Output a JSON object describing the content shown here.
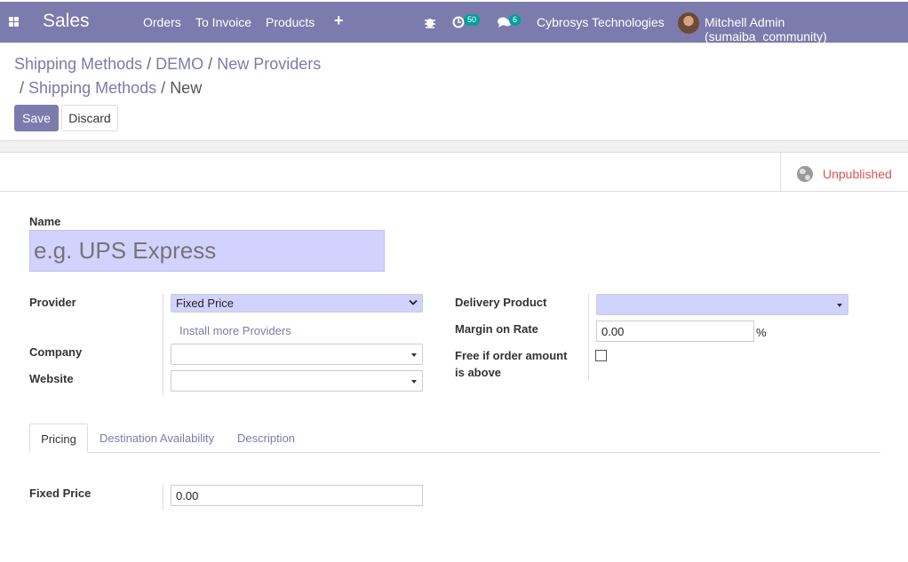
{
  "navbar": {
    "app_name": "Sales",
    "menu": [
      "Orders",
      "To Invoice",
      "Products"
    ],
    "plus_icon": "+",
    "activity_count": "50",
    "message_count": "6",
    "company": "Cybrosys Technologies",
    "user": "Mitchell Admin (sumaiba_community)"
  },
  "breadcrumb": {
    "items": [
      "Shipping Methods",
      "DEMO",
      "New Providers",
      "Shipping Methods"
    ],
    "separator": "/",
    "current": "New"
  },
  "buttons": {
    "save": "Save",
    "discard": "Discard"
  },
  "publish": {
    "label": "Unpublished"
  },
  "form": {
    "name_label": "Name",
    "name_placeholder": "e.g. UPS Express",
    "provider_label": "Provider",
    "provider_value": "Fixed Price",
    "install_link": "Install more Providers",
    "company_label": "Company",
    "company_value": "",
    "website_label": "Website",
    "website_value": "",
    "delivery_product_label": "Delivery Product",
    "delivery_product_value": "",
    "margin_label": "Margin on Rate",
    "margin_value": "0.00",
    "margin_unit": "%",
    "free_label_1": "Free if order amount",
    "free_label_2": "is above",
    "free_checked": false
  },
  "tabs": [
    "Pricing",
    "Destination Availability",
    "Description"
  ],
  "pricing": {
    "fixed_price_label": "Fixed Price",
    "fixed_price_value": "0.00"
  },
  "colors": {
    "brand": "#7c7bad",
    "required_bg": "#d2d2ff",
    "unpublished": "#d9534f",
    "badge": "#00a09d"
  },
  "icons": [
    "apps-grid-icon",
    "bug-icon",
    "activity-clock-icon",
    "chat-icon",
    "globe-icon",
    "chevron-down-icon",
    "caret-down-icon"
  ]
}
